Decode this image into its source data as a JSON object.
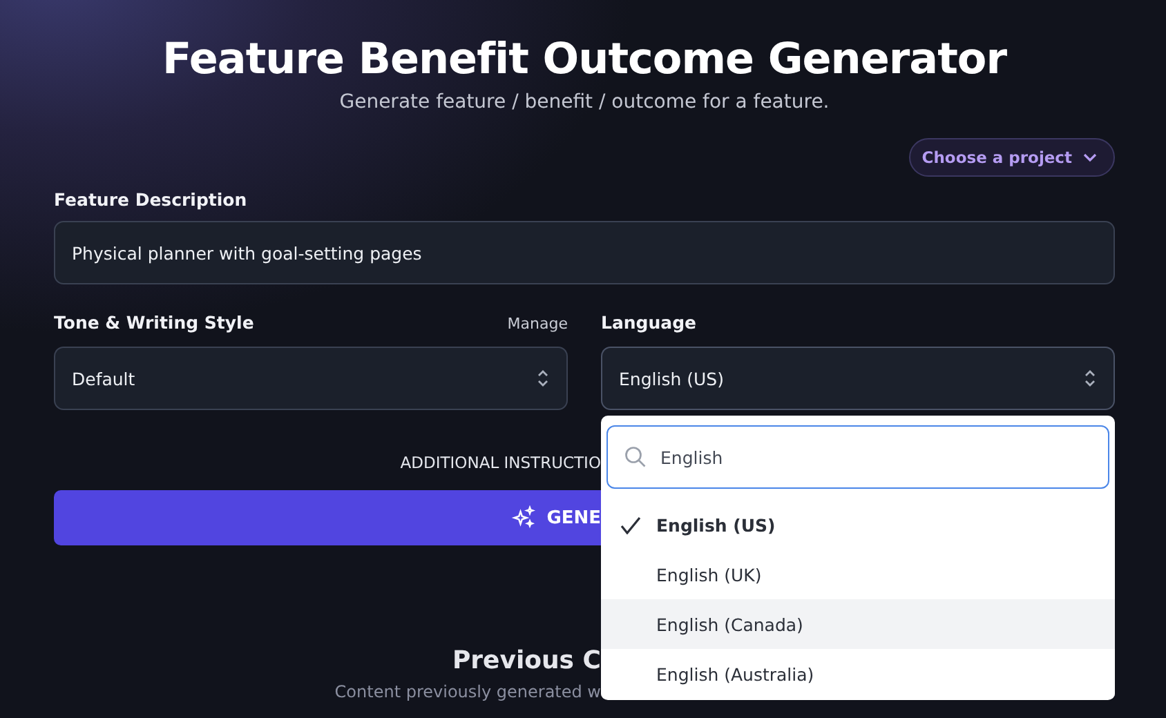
{
  "header": {
    "title": "Feature Benefit Outcome Generator",
    "subtitle": "Generate feature / benefit / outcome for a feature."
  },
  "project_button": {
    "label": "Choose a project"
  },
  "feature": {
    "label": "Feature Description",
    "value": "Physical planner with goal-setting pages"
  },
  "tone": {
    "label": "Tone & Writing Style",
    "manage": "Manage",
    "value": "Default"
  },
  "language": {
    "label": "Language",
    "value": "English (US)",
    "expanded": true,
    "search": {
      "value": "English"
    },
    "options": [
      {
        "label": "English (US)",
        "selected": true,
        "hovered": false
      },
      {
        "label": "English (UK)",
        "selected": false,
        "hovered": false
      },
      {
        "label": "English (Canada)",
        "selected": false,
        "hovered": true
      },
      {
        "label": "English (Australia)",
        "selected": false,
        "hovered": false
      }
    ]
  },
  "additional_instructions": "ADDITIONAL INSTRUCTIO",
  "generate_button": {
    "label": "GENE"
  },
  "previous": {
    "title": "Previous C",
    "subtitle": "Content previously generated w"
  }
}
